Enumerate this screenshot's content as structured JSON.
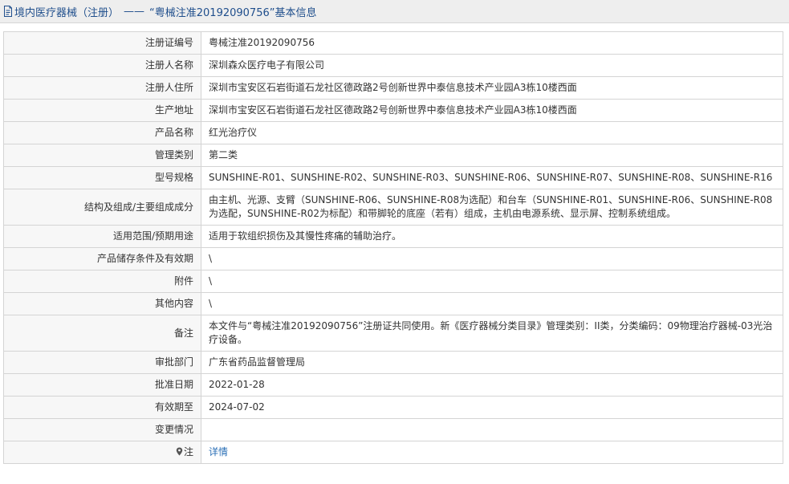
{
  "header": {
    "category": "境内医疗器械（注册）",
    "separator": "——",
    "title": "“粤械注准20192090756”基本信息"
  },
  "rows": [
    {
      "label": "注册证编号",
      "value": "粤械注准20192090756"
    },
    {
      "label": "注册人名称",
      "value": "深圳森众医疗电子有限公司"
    },
    {
      "label": "注册人住所",
      "value": "深圳市宝安区石岩街道石龙社区德政路2号创新世界中泰信息技术产业园A3栋10楼西面"
    },
    {
      "label": "生产地址",
      "value": "深圳市宝安区石岩街道石龙社区德政路2号创新世界中泰信息技术产业园A3栋10楼西面"
    },
    {
      "label": "产品名称",
      "value": "红光治疗仪"
    },
    {
      "label": "管理类别",
      "value": "第二类"
    },
    {
      "label": "型号规格",
      "value": "SUNSHINE-R01、SUNSHINE-R02、SUNSHINE-R03、SUNSHINE-R06、SUNSHINE-R07、SUNSHINE-R08、SUNSHINE-R16"
    },
    {
      "label": "结构及组成/主要组成成分",
      "value": "由主机、光源、支臂（SUNSHINE-R06、SUNSHINE-R08为选配）和台车（SUNSHINE-R01、SUNSHINE-R06、SUNSHINE-R08为选配，SUNSHINE-R02为标配）和带脚轮的底座（若有）组成，主机由电源系统、显示屏、控制系统组成。"
    },
    {
      "label": "适用范围/预期用途",
      "value": "适用于软组织损伤及其慢性疼痛的辅助治疗。"
    },
    {
      "label": "产品储存条件及有效期",
      "value": "\\"
    },
    {
      "label": "附件",
      "value": "\\"
    },
    {
      "label": "其他内容",
      "value": "\\"
    },
    {
      "label": "备注",
      "value": "本文件与“粤械注准20192090756”注册证共同使用。新《医疗器械分类目录》管理类别：II类，分类编码：09物理治疗器械-03光治疗设备。"
    },
    {
      "label": "审批部门",
      "value": "广东省药品监督管理局"
    },
    {
      "label": "批准日期",
      "value": "2022-01-28"
    },
    {
      "label": "有效期至",
      "value": "2024-07-02"
    },
    {
      "label": "变更情况",
      "value": ""
    }
  ],
  "note": {
    "label": "注",
    "link": "详情"
  },
  "colors": {
    "header_text": "#1f4e8c",
    "link": "#2a6fb6",
    "label_bg": "#f7f7f7"
  }
}
